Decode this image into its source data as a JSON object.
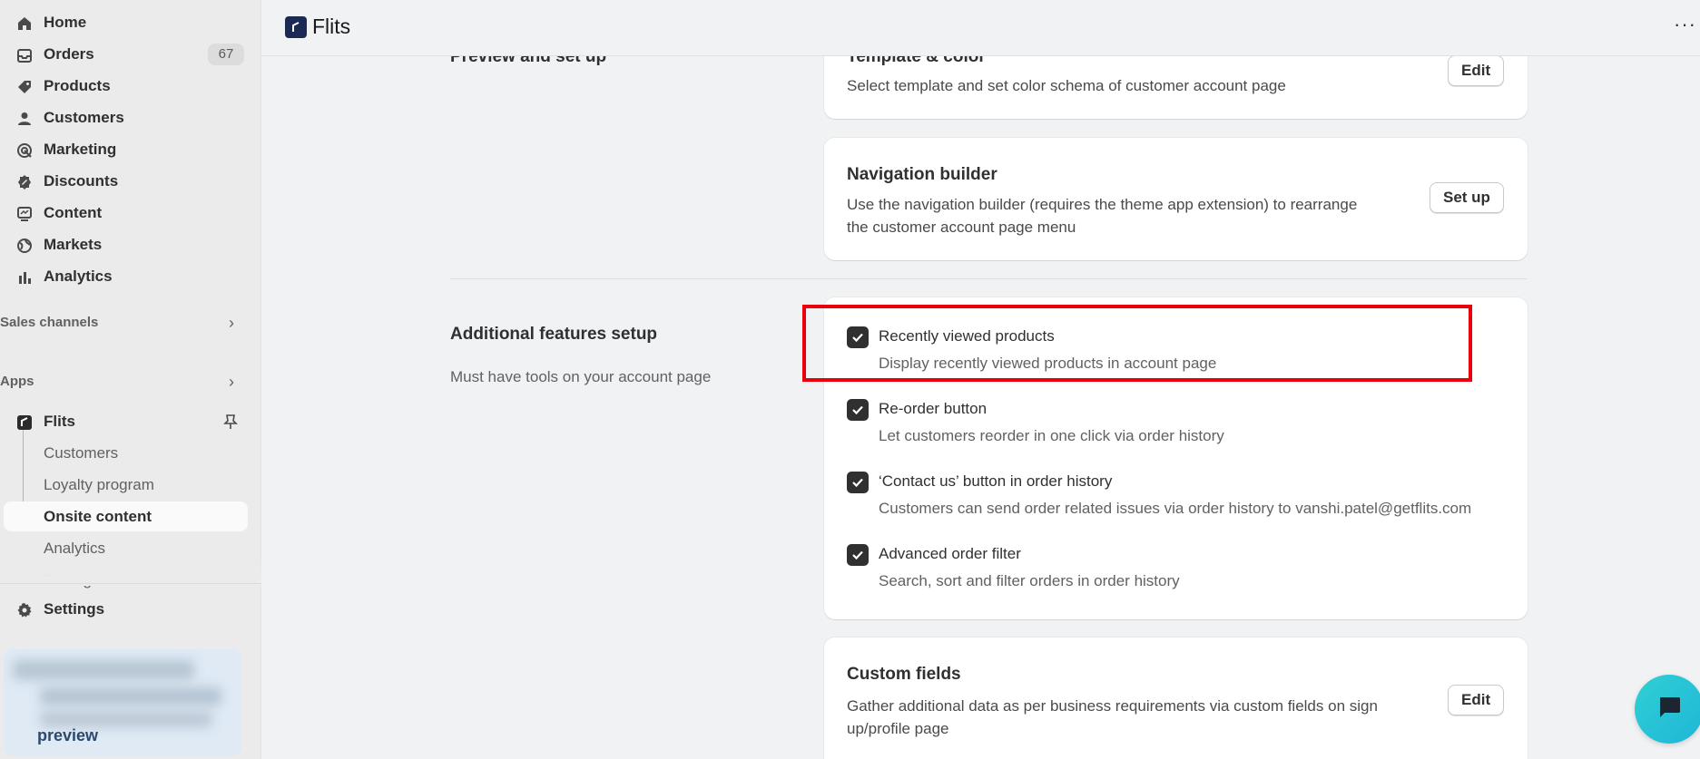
{
  "sidebar": {
    "nav": [
      {
        "label": "Home",
        "icon": "home-icon"
      },
      {
        "label": "Orders",
        "icon": "orders-icon",
        "badge": "67"
      },
      {
        "label": "Products",
        "icon": "tag-icon"
      },
      {
        "label": "Customers",
        "icon": "person-icon"
      },
      {
        "label": "Marketing",
        "icon": "target-icon"
      },
      {
        "label": "Discounts",
        "icon": "discount-icon"
      },
      {
        "label": "Content",
        "icon": "content-icon"
      },
      {
        "label": "Markets",
        "icon": "globe-icon"
      },
      {
        "label": "Analytics",
        "icon": "bar-chart-icon"
      }
    ],
    "sales_channels": "Sales channels",
    "apps": "Apps",
    "app_name": "Flits",
    "app_sub": [
      "Customers",
      "Loyalty program",
      "Onsite content",
      "Analytics",
      "Settings"
    ],
    "settings": "Settings",
    "preview": "preview"
  },
  "topbar": {
    "title": "Flits",
    "more": "···"
  },
  "main": {
    "section1_title": "Preview and set up",
    "template_card": {
      "title": "Template & color",
      "desc": "Select template and set color schema of customer account page",
      "button": "Edit"
    },
    "nav_card": {
      "title": "Navigation builder",
      "desc": "Use the navigation builder (requires the theme app extension) to rearrange the customer account page menu",
      "button": "Set up"
    },
    "section2_title": "Additional features setup",
    "section2_sub": "Must have tools on your account page",
    "features": [
      {
        "title": "Recently viewed products",
        "desc": "Display recently viewed products in account page",
        "checked": true
      },
      {
        "title": "Re-order button",
        "desc": "Let customers reorder in one click via order history",
        "checked": true
      },
      {
        "title": "‘Contact us’ button in order history",
        "desc": "Customers can send order related issues via order history to vanshi.patel@getflits.com",
        "checked": true
      },
      {
        "title": "Advanced order filter",
        "desc": "Search, sort and filter orders in order history",
        "checked": true
      }
    ],
    "custom_card": {
      "title": "Custom fields",
      "desc": "Gather additional data as per business requirements via custom fields on sign up/profile page",
      "button": "Edit"
    }
  },
  "colors": {
    "highlight": "#e8000b",
    "checkbox": "#303030",
    "chat": "#2fd0d4"
  }
}
